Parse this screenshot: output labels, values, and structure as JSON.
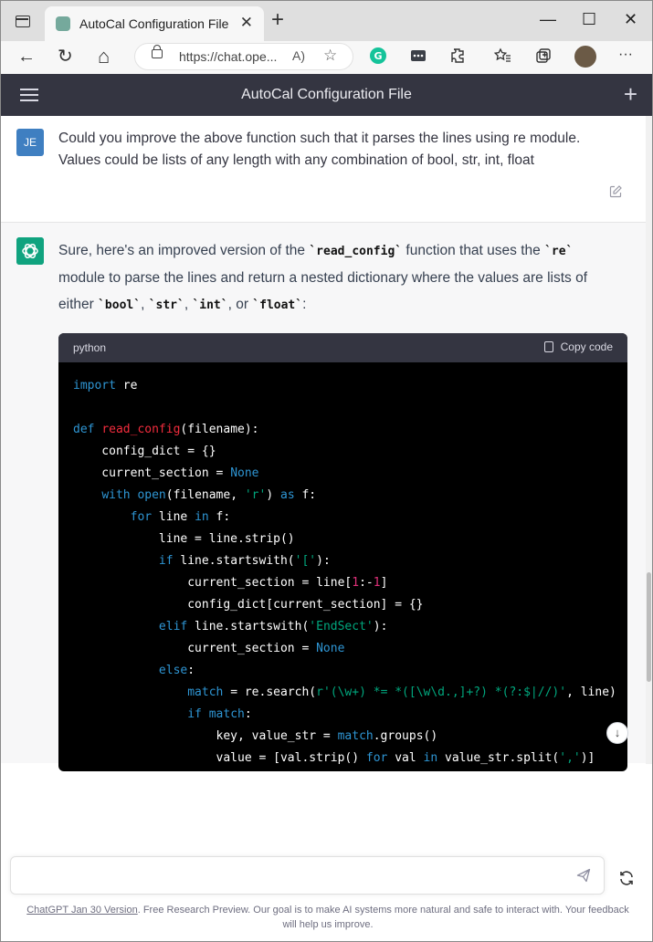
{
  "browser": {
    "tab_title": "AutoCal Configuration File",
    "tab_close": "✕",
    "new_tab": "+",
    "win_min": "—",
    "win_max": "☐",
    "win_close": "✕",
    "url": "https://chat.ope...",
    "read_aloud": "A)",
    "icons": {
      "back": "←",
      "refresh": "↻",
      "home": "⌂",
      "more": "···"
    }
  },
  "chat_header": {
    "title": "AutoCal Configuration File",
    "new_chat": "+"
  },
  "user_message": {
    "avatar_initials": "JE",
    "text": "Could you improve the above function such that it parses the lines using re module. Values could be lists of any length with any combination of bool, str, int, float"
  },
  "assistant_message": {
    "intro_1": "Sure, here's an improved version of the ",
    "code_read_config": "`read_config`",
    "intro_2": " function that uses the ",
    "code_re": "`re`",
    "intro_3": " module to parse the lines and return a nested dictionary where the values are lists of either ",
    "code_bool": "`bool`",
    "sep_1": ", ",
    "code_str": "`str`",
    "sep_2": ", ",
    "code_int": "`int`",
    "sep_3": ", or ",
    "code_float": "`float`",
    "end": ":",
    "code_block": {
      "language": "python",
      "copy_label": "Copy code",
      "tokens": [
        [
          "import",
          " re\n\n"
        ],
        [
          "def",
          " "
        ],
        [
          "read_config",
          "(filename):\n    config_dict = {}\n    current_section = "
        ],
        [
          "None",
          "\n    "
        ],
        [
          "with",
          " "
        ],
        [
          "open",
          "(filename, "
        ],
        [
          "'r'",
          ") "
        ],
        [
          "as",
          " f:\n        "
        ],
        [
          "for",
          " line "
        ],
        [
          "in",
          " f:\n            line = line.strip()\n            "
        ],
        [
          "if",
          " line.startswith("
        ],
        [
          "'['",
          "):\n                current_section = line["
        ],
        [
          "1",
          ":-"
        ],
        [
          "1",
          "]\n                config_dict[current_section] = {}\n            "
        ],
        [
          "elif",
          " line.startswith("
        ],
        [
          "'EndSect'",
          "):\n                current_section = "
        ],
        [
          "None",
          "\n            "
        ],
        [
          "else",
          ":\n                "
        ],
        [
          "match",
          " = re.search("
        ],
        [
          "r'(\\w+) *= *([\\w\\d.,]+?) *(?:$|//)'",
          ", line)\n                "
        ],
        [
          "if",
          " "
        ],
        [
          "match",
          ":\n                    key, value_str = "
        ],
        [
          "match",
          ".groups()\n                    value = [val.strip() "
        ],
        [
          "for",
          " val "
        ],
        [
          "in",
          " value_str.split("
        ],
        [
          "','",
          ")]"
        ]
      ],
      "token_classes": [
        "kw",
        "",
        "kw",
        "",
        "fn",
        "",
        "kw",
        "",
        "kw",
        "",
        "kw",
        "",
        "st",
        "",
        "kw",
        "",
        "kw",
        "",
        "kw",
        "",
        "kw",
        "",
        "st",
        "",
        "nm",
        "",
        "nm",
        "",
        "kw",
        "",
        "st",
        "",
        "kw",
        "",
        "kw",
        "",
        "kw",
        "",
        "st",
        "",
        "kw",
        "",
        "kw",
        "",
        "kw",
        "",
        "kw",
        "",
        "kw",
        "",
        "st",
        ""
      ]
    }
  },
  "composer": {
    "placeholder": "",
    "footer_link": "ChatGPT Jan 30 Version",
    "footer_text": ". Free Research Preview. Our goal is to make AI systems more natural and safe to interact with. Your feedback will help us improve."
  },
  "colors": {
    "header_bg": "#343541",
    "assistant_bg": "#f7f7f8",
    "code_bg": "#000000",
    "keyword": "#2e95d3",
    "string": "#00a67d",
    "function": "#f22c3d",
    "number": "#df3079"
  }
}
